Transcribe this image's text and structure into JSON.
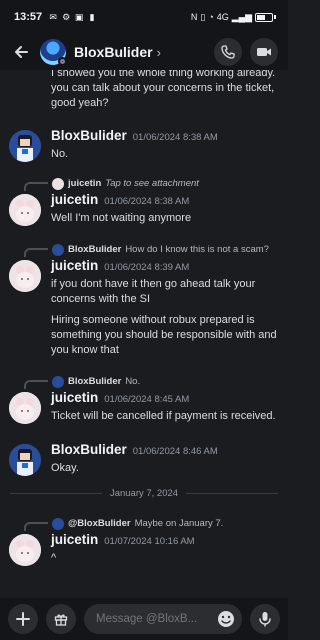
{
  "status_bar": {
    "time": "13:57",
    "network": "4G",
    "battery_percent": 60
  },
  "header": {
    "name": "BloxBulider",
    "chevron": "›",
    "icons": [
      "back-arrow-icon",
      "phone-icon",
      "video-camera-icon"
    ]
  },
  "messages": [
    {
      "kind": "continuation",
      "lines": [
        "I showed you the whole thing working already.",
        "you can talk about your concerns in the ticket, good yeah?"
      ]
    },
    {
      "kind": "message",
      "author": "BloxBulider",
      "timestamp": "01/06/2024 8:38 AM",
      "lines": [
        "No."
      ]
    },
    {
      "kind": "message",
      "author": "juicetin",
      "timestamp": "01/06/2024 8:38 AM",
      "reply": {
        "name": "juicetin",
        "text": "Tap to see attachment"
      },
      "lines": [
        "Well I'm not waiting anymore"
      ]
    },
    {
      "kind": "message",
      "author": "juicetin",
      "timestamp": "01/06/2024 8:39 AM",
      "reply": {
        "name": "BloxBulider",
        "text": "How do I know this is not a scam?"
      },
      "lines": [
        "if you dont have it then go ahead talk your concerns with the SI",
        "Hiring someone without robux prepared is something you should be responsible with and you know that"
      ]
    },
    {
      "kind": "message",
      "author": "juicetin",
      "timestamp": "01/06/2024 8:45 AM",
      "reply": {
        "name": "BloxBulider",
        "text": "No."
      },
      "lines": [
        "Ticket will be cancelled if payment is received."
      ]
    },
    {
      "kind": "message",
      "author": "BloxBulider",
      "timestamp": "01/06/2024 8:46 AM",
      "lines": [
        "Okay."
      ]
    },
    {
      "kind": "divider",
      "label": "January 7, 2024"
    },
    {
      "kind": "message",
      "author": "juicetin",
      "timestamp": "01/07/2024 10:16 AM",
      "reply": {
        "name": "@BloxBulider",
        "text": "Maybe on January 7."
      },
      "lines": [
        "^"
      ]
    }
  ],
  "composer": {
    "placeholder": "Message @BloxB...",
    "icons": [
      "plus-icon",
      "gift-icon",
      "emoji-icon",
      "microphone-icon"
    ]
  },
  "colors": {
    "background": "#1b1c20",
    "bar": "#141518",
    "button": "#2b2d31",
    "text": "#dbdee1",
    "muted": "#949ba4"
  }
}
